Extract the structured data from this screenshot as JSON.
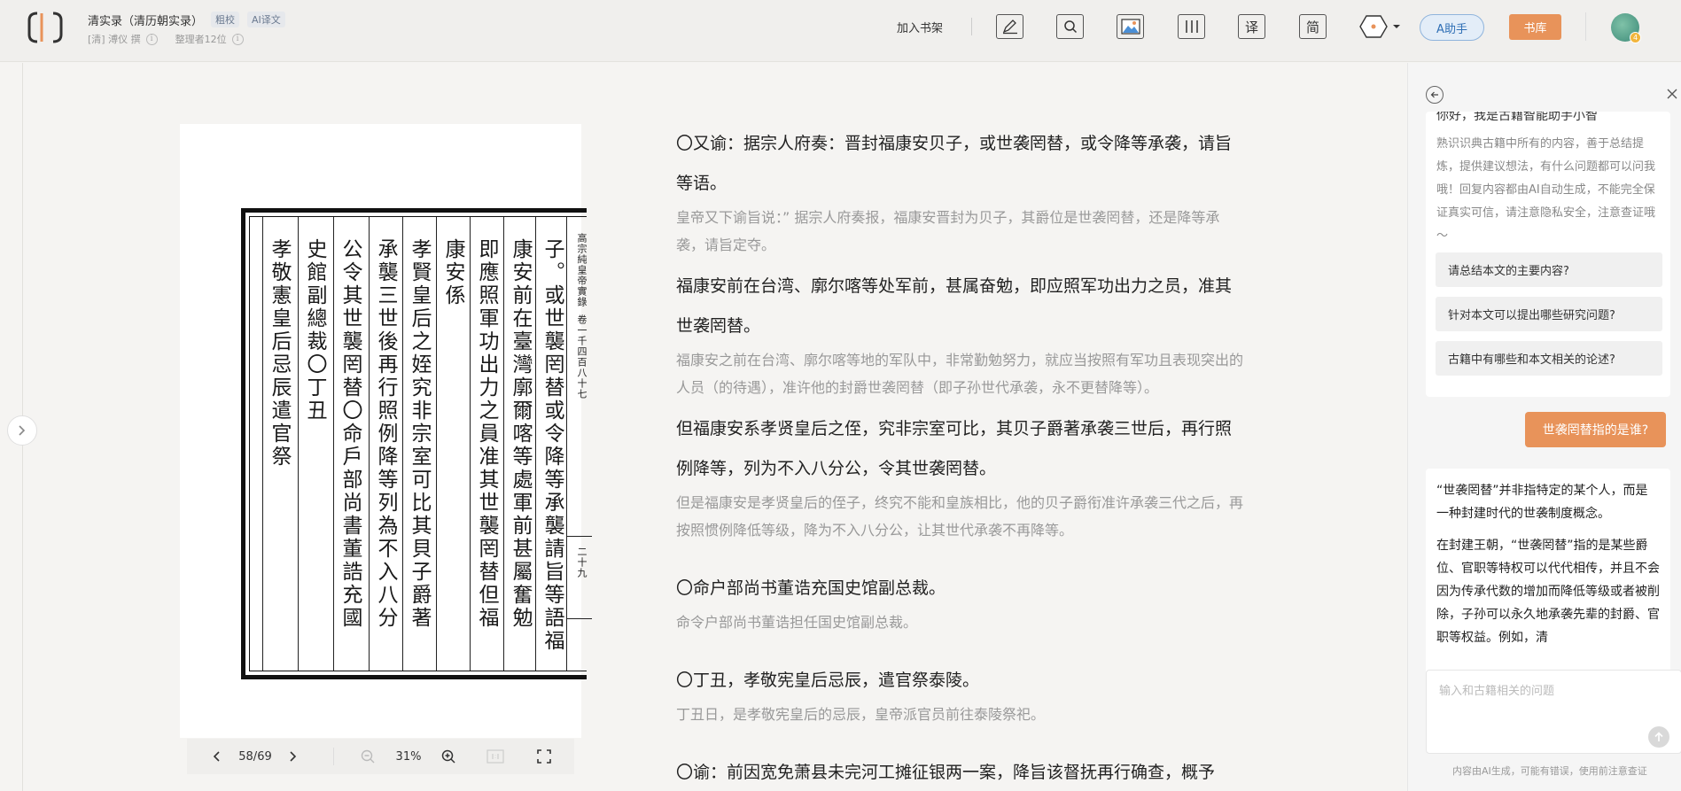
{
  "header": {
    "book_title": "清实录（清历朝实录）",
    "tag_proofread": "粗校",
    "tag_ai": "AI译文",
    "author": "[清] 溥仪 撰",
    "collators": "整理者12位",
    "add_shelf": "加入书架",
    "tools": {
      "annotate": "pen-icon",
      "search": "search-icon",
      "image": "image-icon",
      "columns": "columns-icon",
      "translate_label": "译",
      "simplified_label": "简",
      "hex": "hexagon-icon"
    },
    "assistant_label": "A助手",
    "library_label": "书库",
    "avatar_badge": "4"
  },
  "scan": {
    "columns": [
      "子。或世襲罔替或令降等承襲請旨等語福",
      "康安前在臺灣廓爾喀等處軍前甚屬奮勉",
      "即應照軍功出力之員准其世襲罔替但福",
      "康安係",
      "孝賢皇后之姪究非宗室可比其貝子爵著",
      "承襲三世後再行照例降等列為不入八分",
      "公令其世襲罔替〇命戶部尚書董誥充國",
      "史館副總裁〇丁丑",
      "孝敬憲皇后忌辰遣官祭"
    ],
    "margin_title": "高宗純皇帝實錄",
    "margin_volume": "卷一千四百八十七",
    "margin_page": "二十九",
    "toolbar": {
      "page": "58/69",
      "zoom": "31%"
    }
  },
  "content": [
    {
      "orig": "〇又谕：据宗人府奏：晋封福康安贝子，或世袭罔替，或令降等承袭，请旨等语。",
      "trans": "皇帝又下谕旨说：” 据宗人府奏报，福康安晋封为贝子，其爵位是世袭罔替，还是降等承袭，请旨定夺。"
    },
    {
      "orig": "福康安前在台湾、廓尔喀等处军前，甚属奋勉，即应照军功出力之员，准其世袭罔替。",
      "trans": "福康安之前在台湾、廓尔喀等地的军队中，非常勤勉努力，就应当按照有军功且表现突出的人员（的待遇），准许他的封爵世袭罔替（即子孙世代承袭，永不更替降等）。"
    },
    {
      "orig": "但福康安系孝贤皇后之侄，究非宗室可比，其贝子爵著承袭三世后，再行照例降等，列为不入八分公，令其世袭罔替。",
      "trans": "但是福康安是孝贤皇后的侄子，终究不能和皇族相比，他的贝子爵衔准许承袭三代之后，再按照惯例降低等级，降为不入八分公，让其世代承袭不再降等。"
    },
    {
      "orig": "〇命户部尚书董诰充国史馆副总裁。",
      "trans": "命令户部尚书董诰担任国史馆副总裁。"
    },
    {
      "orig": "〇丁丑，孝敬宪皇后忌辰，遣官祭泰陵。",
      "trans": "丁丑日，是孝敬宪皇后的忌辰，皇帝派官员前往泰陵祭祀。"
    },
    {
      "orig": "〇谕：前因宽免萧县未完河工摊征银两一案，降旨该督抚再行确查，概予",
      "trans": ""
    }
  ],
  "panel": {
    "greet_title": "你好，我是古籍智能助手小智",
    "greet_body": "熟识识典古籍中所有的内容，善于总结提炼，提供建议想法，有什么问题都可以问我哦！回复内容都由AI自动生成，不能完全保证真实可信，请注意隐私安全，注意查证哦～",
    "suggestions": [
      "请总结本文的主要内容?",
      "针对本文可以提出哪些研究问题?",
      "古籍中有哪些和本文相关的论述?"
    ],
    "user_question": "世袭罔替指的是谁?",
    "answer": [
      "“世袭罔替”并非指特定的某个人，而是一种封建时代的世袭制度概念。",
      "在封建王朝，“世袭罔替”指的是某些爵位、官职等特权可以代代相传，并且不会因为传承代数的增加而降低等级或者被削除，子孙可以永久地承袭先辈的封爵、官职等权益。例如，清"
    ],
    "input_placeholder": "输入和古籍相关的问题",
    "disclaimer": "内容由AI生成，可能有错误，使用前注意查证"
  }
}
